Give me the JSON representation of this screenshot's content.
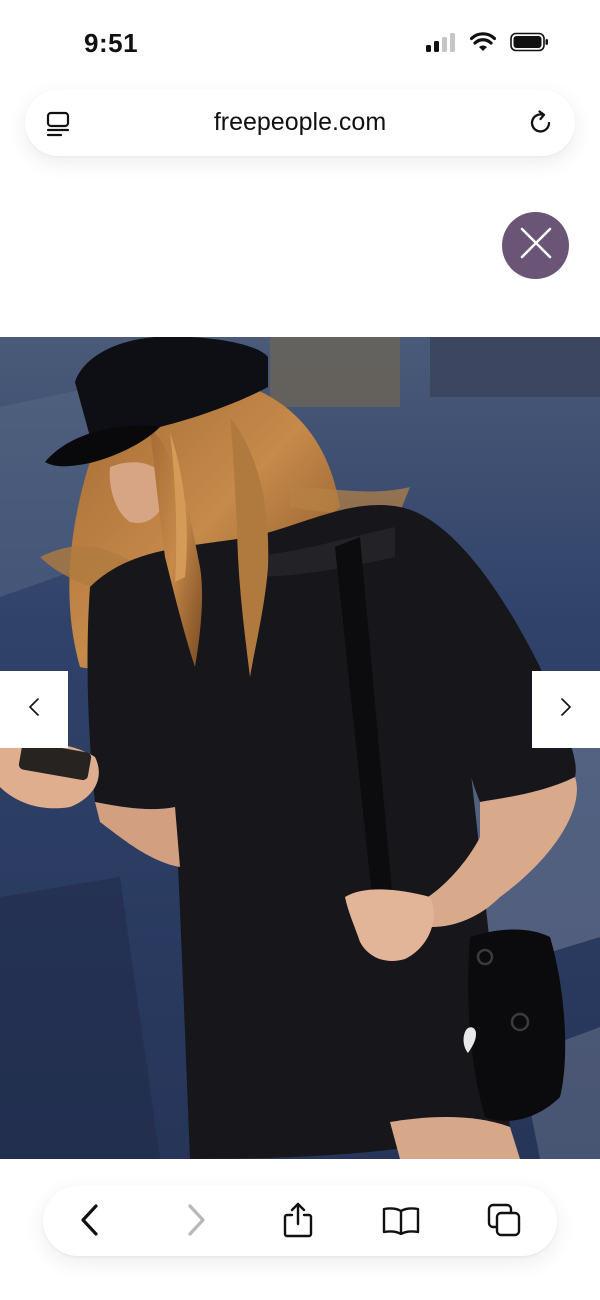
{
  "status_bar": {
    "time": "9:51",
    "icons": [
      "cellular-signal-icon",
      "wifi-icon",
      "battery-icon"
    ]
  },
  "browser": {
    "url": "freepeople.com",
    "left_icon": "page-menu-icon",
    "right_icon": "reload-icon"
  },
  "overlay": {
    "close_icon": "close-icon",
    "close_color": "#6b5577"
  },
  "carousel": {
    "prev_icon": "chevron-left-icon",
    "next_icon": "chevron-right-icon"
  },
  "toolbar": {
    "buttons": [
      "back-icon",
      "forward-icon",
      "share-icon",
      "bookmarks-icon",
      "tabs-icon"
    ],
    "forward_disabled": true
  },
  "colors": {
    "accent": "#6b5577",
    "disabled": "#b8b8b8"
  }
}
